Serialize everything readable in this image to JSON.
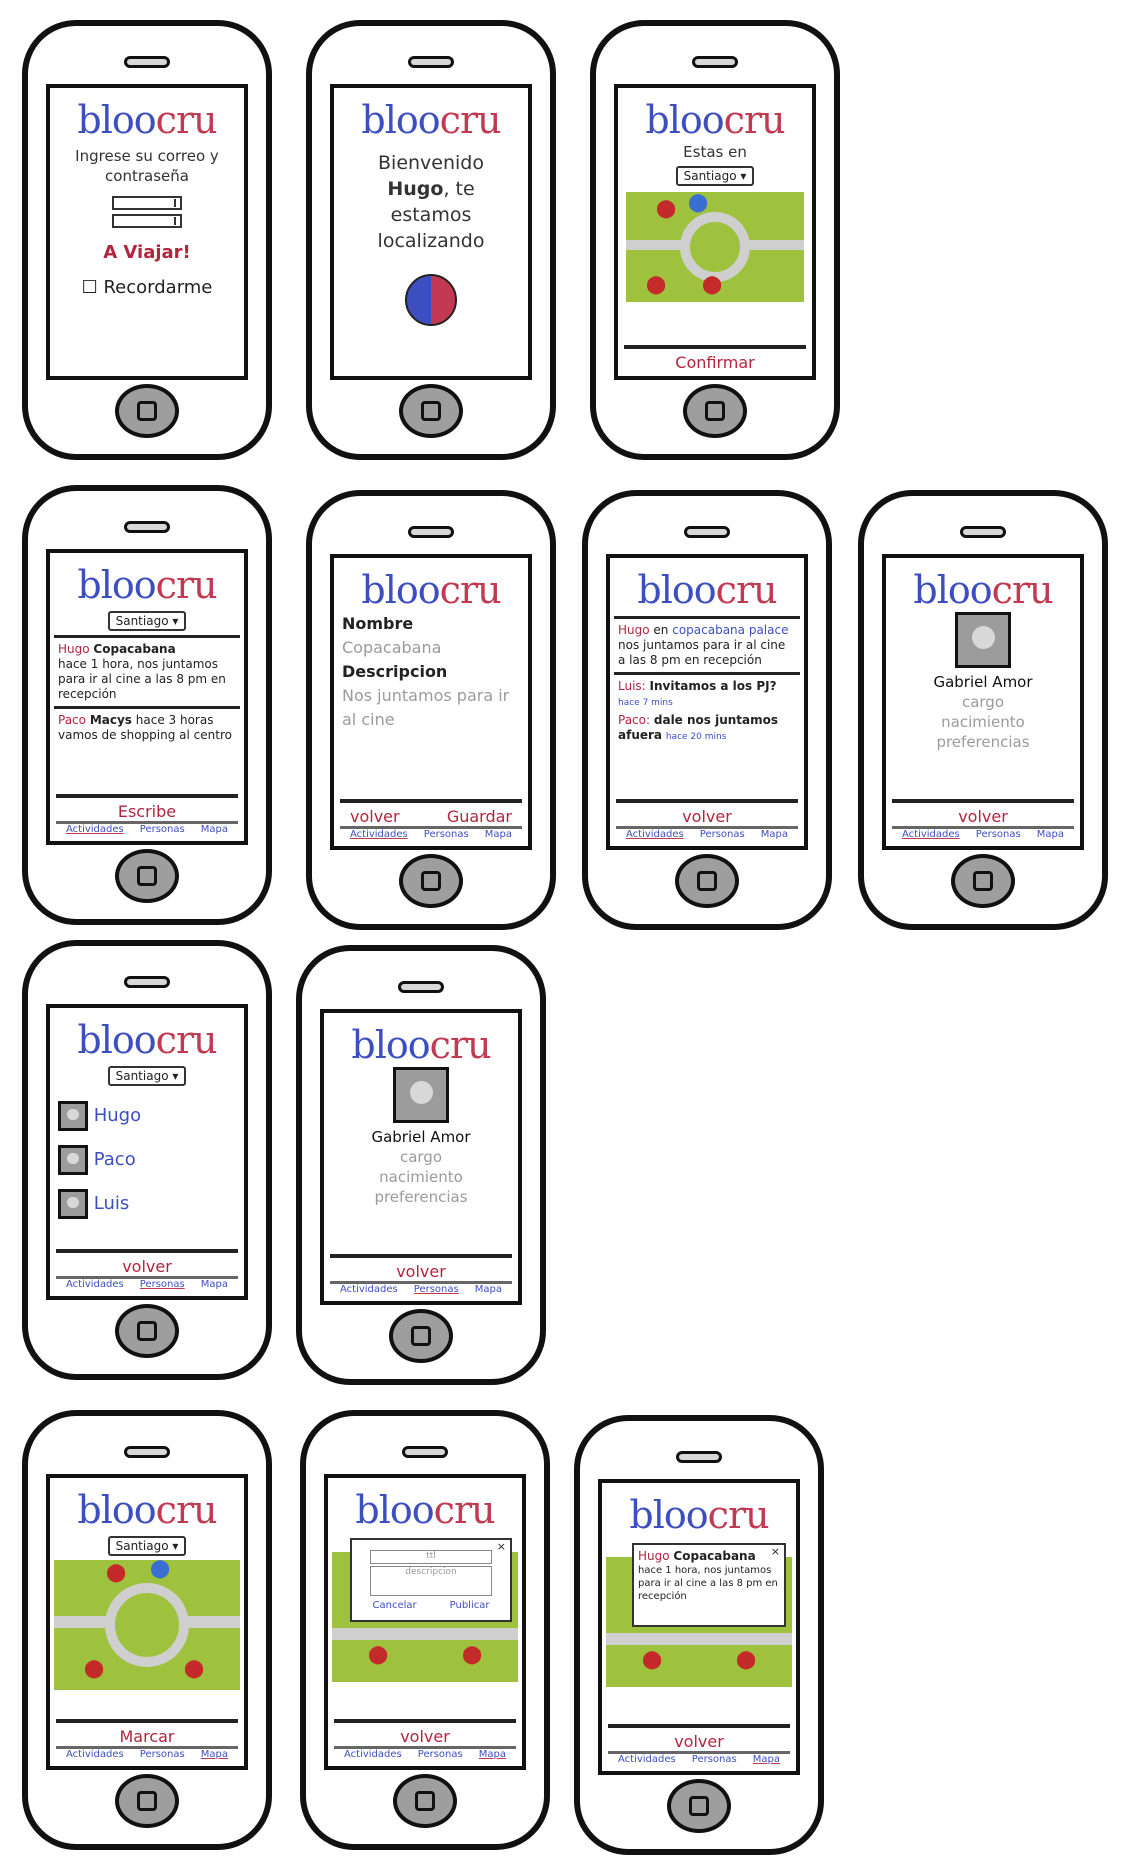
{
  "brand": {
    "logo_a": "bloo",
    "logo_b": "cru",
    "color_blue": "#3d4fc0",
    "color_red": "#c23a52"
  },
  "login": {
    "prompt": "Ingrese su correo y contraseña",
    "go": "A Viajar!",
    "remember": "Recordarme",
    "checkbox": "☐"
  },
  "welcome": {
    "line1": "Bienvenido",
    "name": "Hugo",
    "line2": ", te",
    "line3": "estamos",
    "line4": "localizando"
  },
  "location": {
    "label": "Estas en",
    "city": "Santiago ▾",
    "confirm": "Confirmar"
  },
  "tabs": {
    "actividades": "Actividades",
    "personas": "Personas",
    "mapa": "Mapa"
  },
  "activities": {
    "city": "Santiago ▾",
    "item1": {
      "user": "Hugo",
      "place": "Copacabana",
      "time": "hace 1 hora,",
      "text": "nos juntamos para ir al cine a las 8 pm en recepción"
    },
    "item2": {
      "user": "Paco",
      "place": "Macys",
      "time": "hace 3 horas",
      "text": "vamos de shopping al centro"
    },
    "action": "Escribe"
  },
  "new_activity": {
    "name_label": "Nombre",
    "name_value": "Copacabana",
    "desc_label": "Descripcion",
    "desc_value": "Nos juntamos para ir al cine",
    "back": "volver",
    "save": "Guardar"
  },
  "thread": {
    "post_user": "Hugo",
    "post_en": " en ",
    "post_place": "copacabana palace",
    "post_text": "nos juntamos para ir al cine a las 8 pm en recepción",
    "reply1_user": "Luis:",
    "reply1_text": "Invitamos a los PJ?",
    "reply1_time": "hace 7 mins",
    "reply2_user": "Paco:",
    "reply2_text": "dale nos juntamos afuera",
    "reply2_time": "hace 20 mins",
    "back": "volver"
  },
  "profile": {
    "name": "Gabriel Amor",
    "f1": "cargo",
    "f2": "nacimiento",
    "f3": "preferencias",
    "back": "volver"
  },
  "people": {
    "city": "Santiago ▾",
    "p1": "Hugo",
    "p2": "Paco",
    "p3": "Luis",
    "back": "volver"
  },
  "map_screen": {
    "city": "Santiago ▾",
    "mark": "Marcar"
  },
  "popup_new": {
    "field1": "ttl",
    "field2": "descripcion",
    "cancel": "Cancelar",
    "publish": "Publicar",
    "close": "×",
    "back": "volver"
  },
  "popup_view": {
    "user": "Hugo",
    "place": "Copacabana",
    "text": "hace 1 hora, nos juntamos para ir al cine a las 8 pm en recepción",
    "close": "×",
    "back": "volver"
  }
}
